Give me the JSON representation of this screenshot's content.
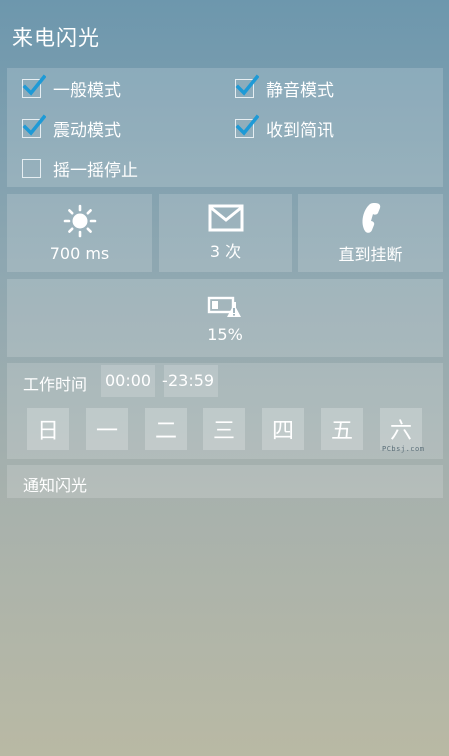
{
  "app": {
    "title": "来电闪光"
  },
  "modes": [
    {
      "label": "一般模式",
      "checked": true
    },
    {
      "label": "静音模式",
      "checked": true
    },
    {
      "label": "震动模式",
      "checked": true
    },
    {
      "label": "收到简讯",
      "checked": true
    },
    {
      "label": "摇一摇停止",
      "checked": false
    }
  ],
  "tiles": {
    "flash_duration": {
      "value": "700 ms",
      "icon": "sun-icon"
    },
    "flash_count": {
      "value": "3 次",
      "icon": "envelope-icon"
    },
    "stop_condition": {
      "value": "直到挂断",
      "icon": "phone-icon"
    },
    "battery_threshold": {
      "value": "15%",
      "icon": "battery-warning-icon"
    }
  },
  "work_time": {
    "label": "工作时间",
    "start": "00:00",
    "separator": "-",
    "end": "23:59",
    "days": [
      "日",
      "一",
      "二",
      "三",
      "四",
      "五",
      "六"
    ]
  },
  "notification": {
    "label": "通知闪光"
  },
  "watermark": "PCbsj.com",
  "colors": {
    "check_accent": "#1e9ad6",
    "panel_fill": "rgba(255,255,255,0.16)"
  }
}
